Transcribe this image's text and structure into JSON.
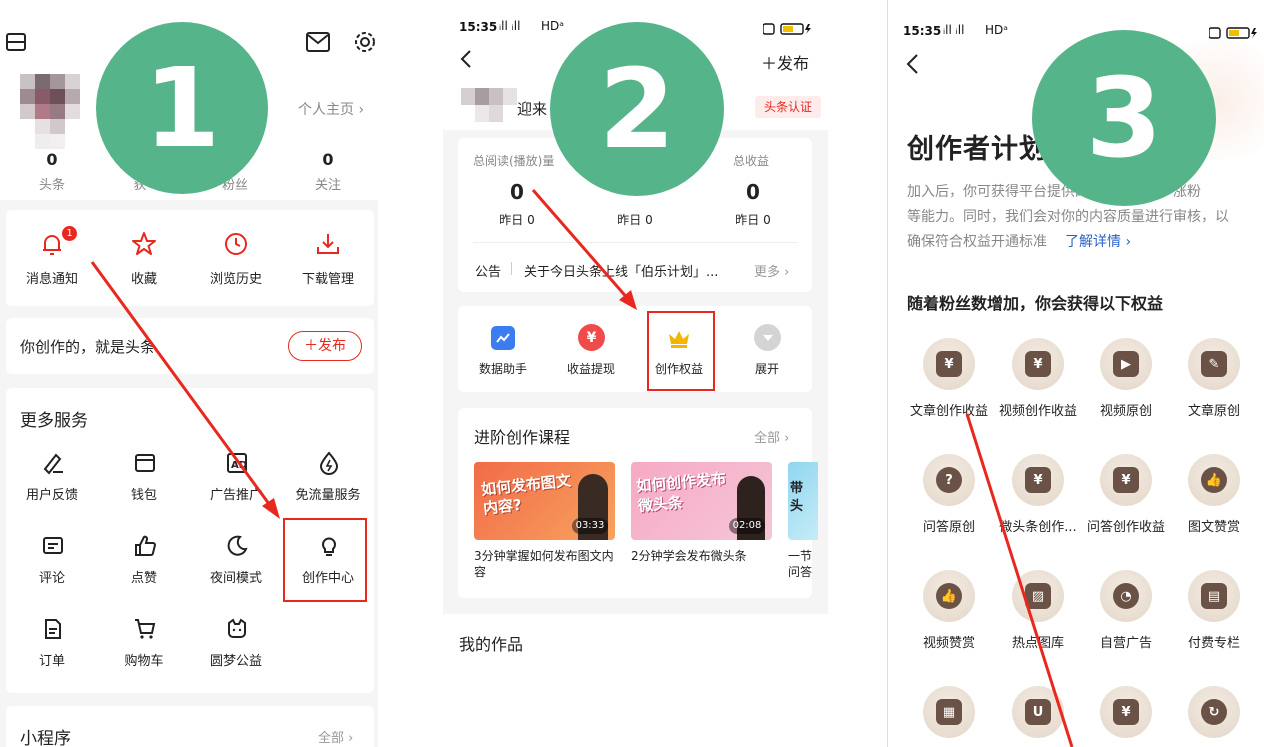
{
  "badge_numbers": [
    "1",
    "2",
    "3"
  ],
  "panel1": {
    "profile_link": "个人主页 ›",
    "stats": [
      {
        "value": "0",
        "label": "头条"
      },
      {
        "value": "",
        "label": "获"
      },
      {
        "value": "",
        "label": "粉丝"
      },
      {
        "value": "0",
        "label": "关注"
      }
    ],
    "quick": [
      {
        "label": "消息通知",
        "icon": "bell-icon",
        "badge": "1"
      },
      {
        "label": "收藏",
        "icon": "star-icon"
      },
      {
        "label": "浏览历史",
        "icon": "clock-icon"
      },
      {
        "label": "下载管理",
        "icon": "download-icon"
      }
    ],
    "create_prompt": "你创作的，就是头条",
    "publish_btn": "＋发布",
    "more_title": "更多服务",
    "services": [
      {
        "label": "用户反馈",
        "icon": "feedback-icon"
      },
      {
        "label": "钱包",
        "icon": "wallet-icon"
      },
      {
        "label": "广告推广",
        "icon": "ad-icon"
      },
      {
        "label": "免流量服务",
        "icon": "data-free-icon"
      },
      {
        "label": "评论",
        "icon": "comment-icon"
      },
      {
        "label": "点赞",
        "icon": "thumbs-up-icon"
      },
      {
        "label": "夜间模式",
        "icon": "moon-icon"
      },
      {
        "label": "创作中心",
        "icon": "lightbulb-icon"
      },
      {
        "label": "订单",
        "icon": "order-icon"
      },
      {
        "label": "购物车",
        "icon": "cart-icon"
      },
      {
        "label": "圆梦公益",
        "icon": "charity-icon"
      }
    ],
    "mini_title": "小程序",
    "mini_all": "全部 ›"
  },
  "panel2": {
    "time": "15:35",
    "signal": "ᵢll ᵢll",
    "wifi": "HDᵃ",
    "publish": "＋发布",
    "welcome": "迎来",
    "cert": "头条认证",
    "stats": [
      {
        "label": "总阅读(播放)量",
        "value": "0",
        "sub": "昨日 0"
      },
      {
        "label": "",
        "value": "",
        "sub": "昨日 0"
      },
      {
        "label": "总收益",
        "value": "0",
        "sub": "昨日 0"
      }
    ],
    "notice_tag": "公告",
    "notice_text": "关于今日头条上线「伯乐计划」...",
    "notice_more": "更多 ›",
    "tools": [
      {
        "label": "数据助手",
        "icon": "chart-icon",
        "color": "#3b7cf0"
      },
      {
        "label": "收益提现",
        "icon": "yen-icon",
        "color": "#f04b4b"
      },
      {
        "label": "创作权益",
        "icon": "crown-icon",
        "color": "#f5b400"
      },
      {
        "label": "展开",
        "icon": "expand-icon",
        "color": "#cfcfcf"
      }
    ],
    "course_title": "进阶创作课程",
    "course_all": "全部 ›",
    "courses": [
      {
        "thumb_text": "如何发布图文内容?",
        "duration": "03:33",
        "title": "3分钟掌握如何发布图文内容"
      },
      {
        "thumb_text": "如何创作发布微头条",
        "duration": "02:08",
        "title": "2分钟学会发布微头条"
      },
      {
        "thumb_text": "带头",
        "duration": "",
        "title": "一节问答"
      }
    ],
    "works_title": "我的作品"
  },
  "panel3": {
    "time": "15:35",
    "signal": "ᵢll ᵢll",
    "wifi": "HDᵃ",
    "title": "创作者计划",
    "desc_line1": "加入后，你可获得平台提供的收益、变现、涨粉",
    "desc_line2": "等能力。同时，我们会对你的内容质量进行审核，以",
    "desc_line3": "确保符合权益开通标准",
    "learn_more": "了解详情 ›",
    "benefits_title": "随着粉丝数增加，你会获得以下权益",
    "benefits": [
      {
        "label": "文章创作收益",
        "glyph": "¥"
      },
      {
        "label": "视频创作收益",
        "glyph": "¥"
      },
      {
        "label": "视频原创",
        "glyph": "▶"
      },
      {
        "label": "文章原创",
        "glyph": "✎"
      },
      {
        "label": "问答原创",
        "glyph": "?"
      },
      {
        "label": "微头条创作...",
        "glyph": "¥"
      },
      {
        "label": "问答创作收益",
        "glyph": "¥"
      },
      {
        "label": "图文赞赏",
        "glyph": "👍"
      },
      {
        "label": "视频赞赏",
        "glyph": "👍"
      },
      {
        "label": "热点图库",
        "glyph": "▨"
      },
      {
        "label": "自营广告",
        "glyph": "◔"
      },
      {
        "label": "付费专栏",
        "glyph": "▤"
      },
      {
        "label": "",
        "glyph": "▦"
      },
      {
        "label": "",
        "glyph": "U"
      },
      {
        "label": "",
        "glyph": "¥"
      },
      {
        "label": "",
        "glyph": "↻"
      }
    ]
  },
  "colors": {
    "accent_red": "#e8281f",
    "badge_green": "#56b48a",
    "link_blue": "#2a62c9"
  }
}
